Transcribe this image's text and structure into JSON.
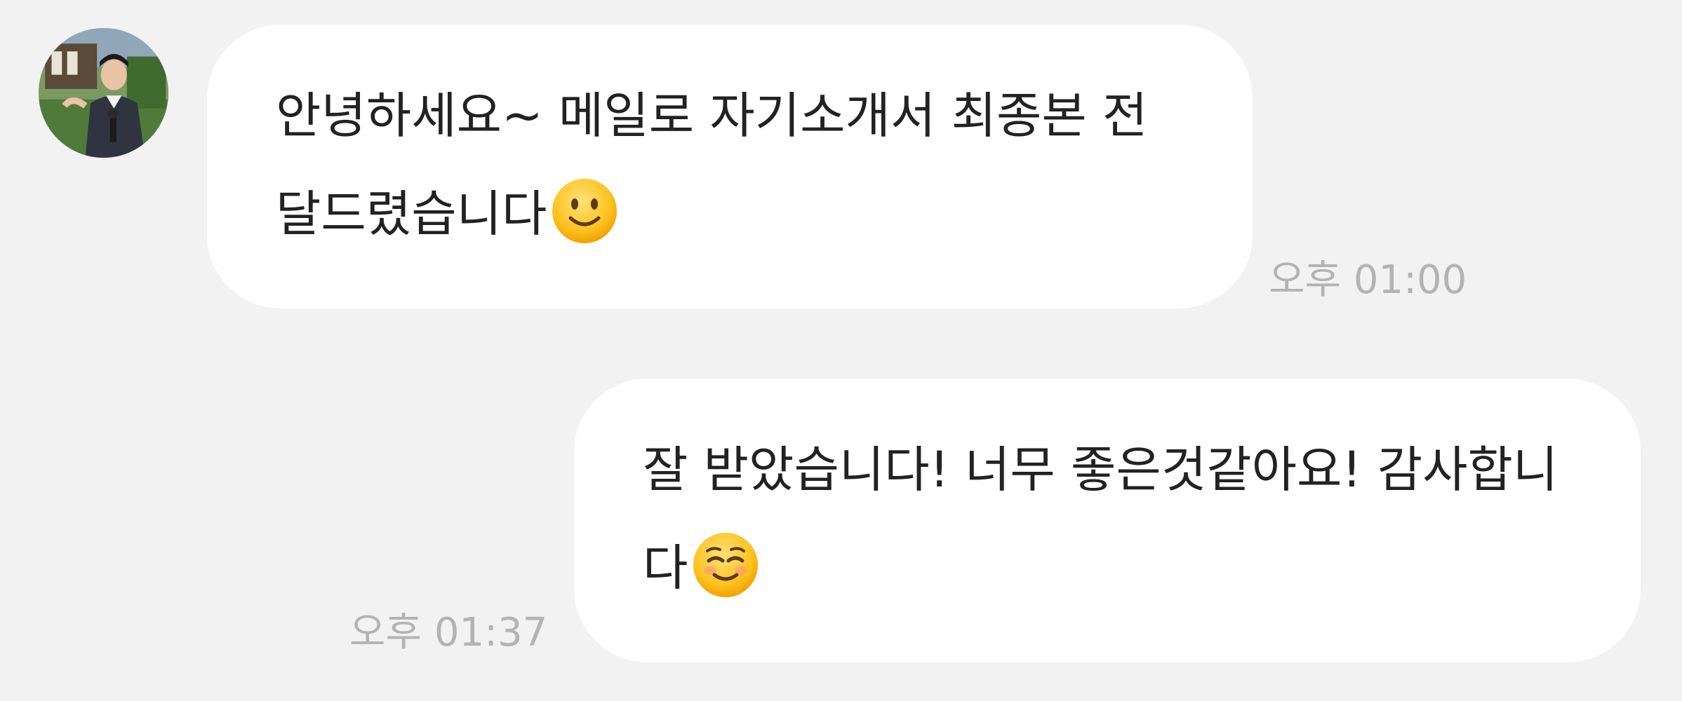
{
  "conversation": {
    "messages": [
      {
        "direction": "incoming",
        "text": "안녕하세요~ 메일로 자기소개서 최종본 전달드렸습니다",
        "emoji": "slightly-smiling-face-icon",
        "time": "오후 01:00"
      },
      {
        "direction": "outgoing",
        "text": "잘 받았습니다! 너무 좋은것같아요! 감사합니다",
        "emoji": "smiling-face-icon",
        "time": "오후 01:37"
      }
    ]
  },
  "colors": {
    "background": "#f2f2f2",
    "bubble": "#ffffff",
    "text": "#222222",
    "timestamp": "#b3b3b3"
  }
}
